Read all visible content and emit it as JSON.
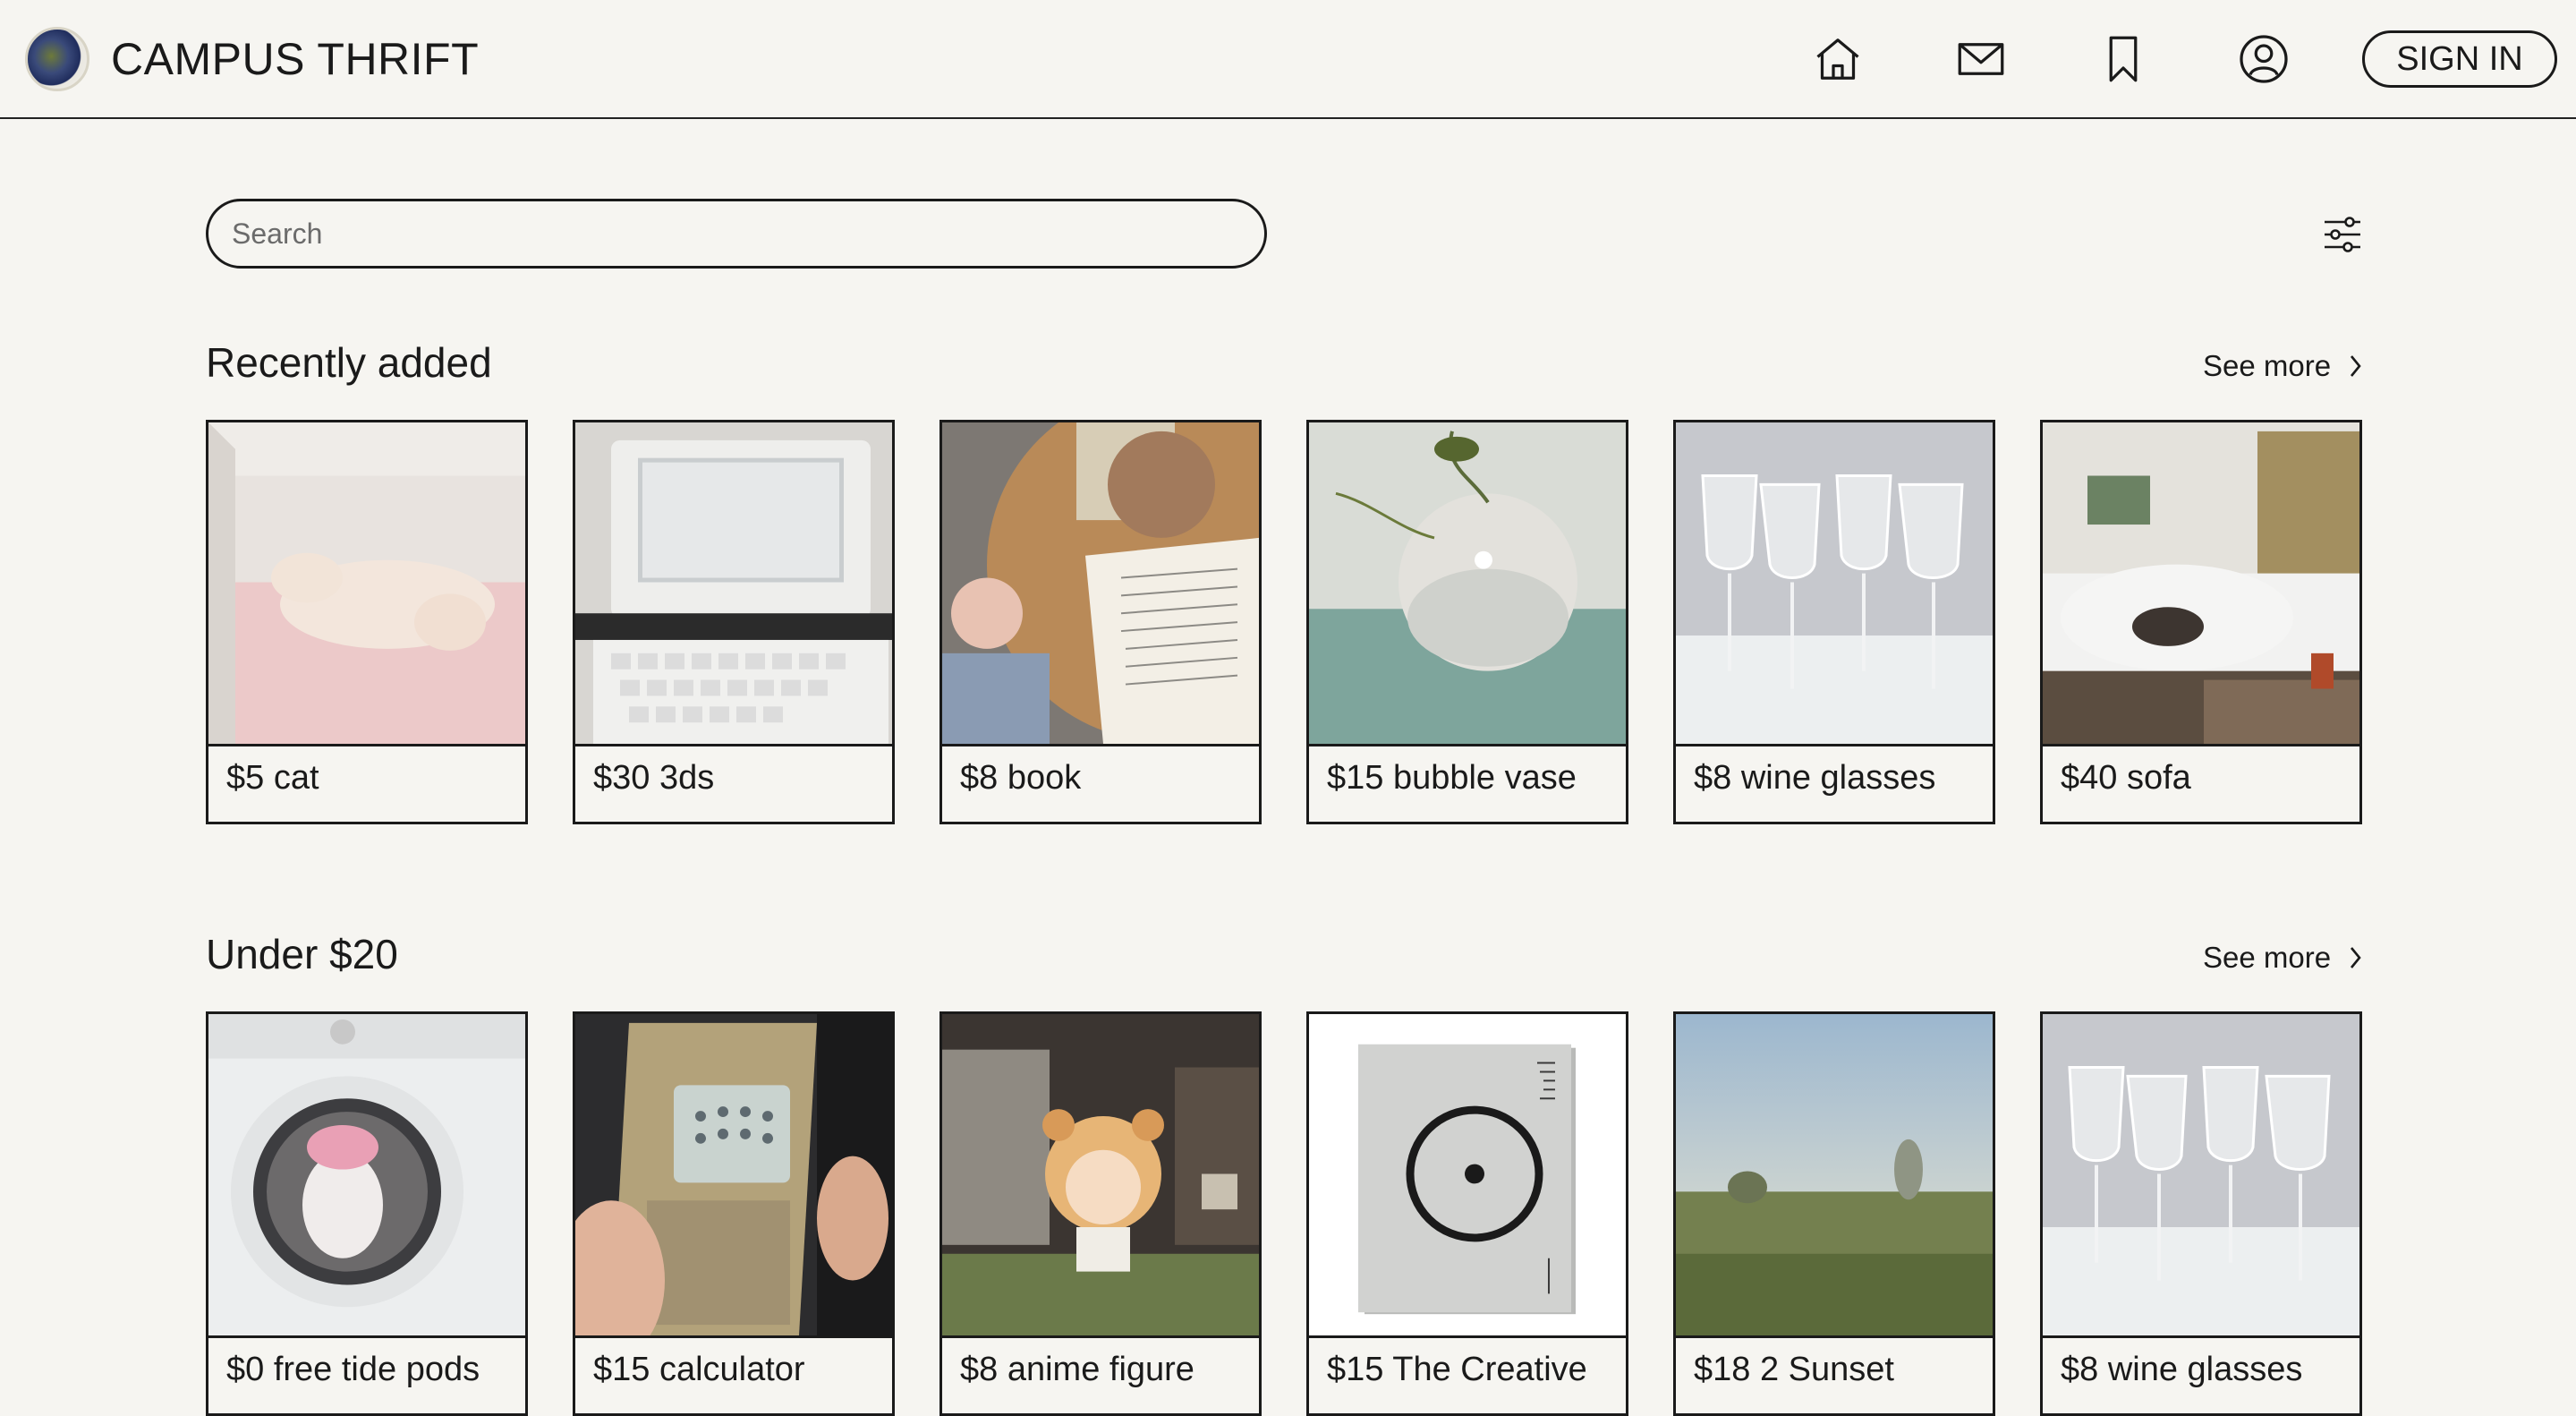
{
  "header": {
    "brand": "CAMPUS THRIFT",
    "signin_label": "SIGN IN"
  },
  "search": {
    "placeholder": "Search"
  },
  "sections": [
    {
      "title": "Recently added",
      "see_more": "See more",
      "items": [
        {
          "label": "$5 cat",
          "image": "kitten-photo"
        },
        {
          "label": "$30 3ds",
          "image": "electronic-dictionary-photo"
        },
        {
          "label": "$8 book",
          "image": "book-and-coffee-photo"
        },
        {
          "label": "$15 bubble vase",
          "image": "bubble-vase-photo"
        },
        {
          "label": "$8 wine glasses",
          "image": "wine-glasses-photo"
        },
        {
          "label": "$40 sofa",
          "image": "sofa-photo"
        }
      ]
    },
    {
      "title": "Under $20",
      "see_more": "See more",
      "items": [
        {
          "label": "$0 free tide pods",
          "image": "washing-machine-photo"
        },
        {
          "label": "$15 calculator",
          "image": "nokia-phone-photo"
        },
        {
          "label": "$8 anime figure",
          "image": "anime-figure-photo"
        },
        {
          "label": "$15 The Creative",
          "image": "book-cover-photo"
        },
        {
          "label": "$18 2 Sunset",
          "image": "sunset-field-photo"
        },
        {
          "label": "$8 wine glasses",
          "image": "wine-glasses-photo"
        }
      ]
    }
  ]
}
